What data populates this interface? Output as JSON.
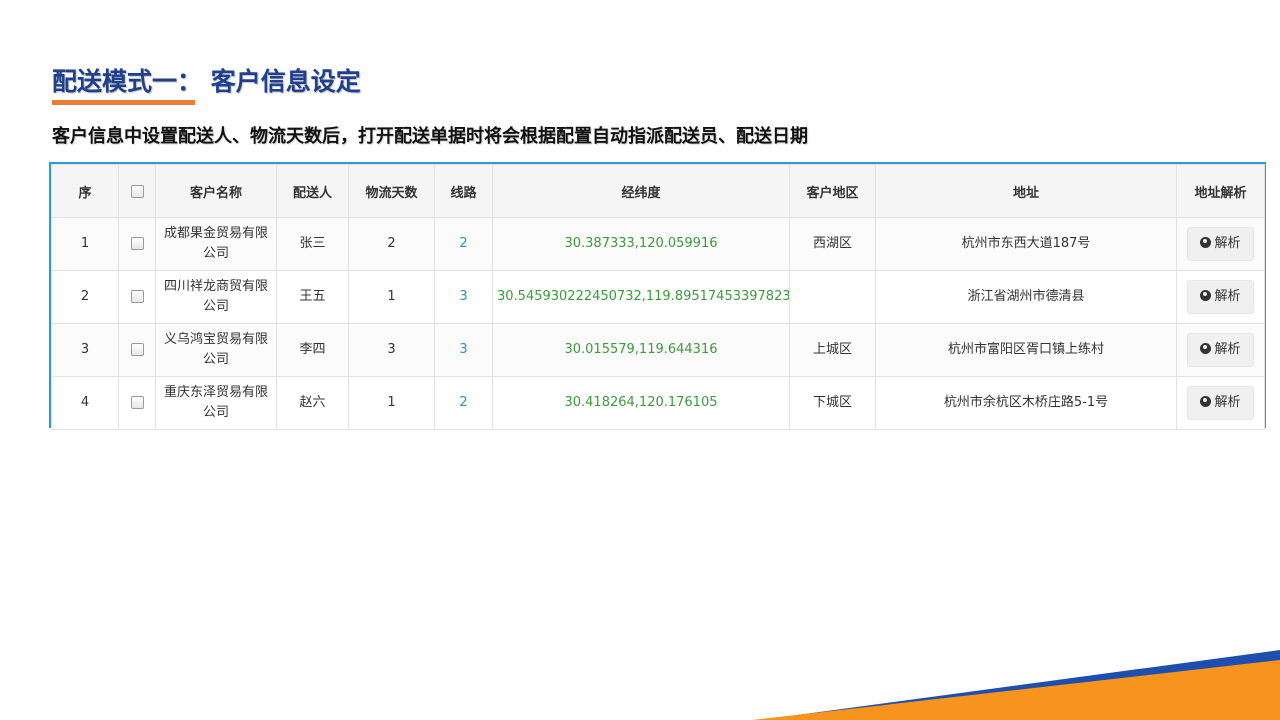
{
  "slide": {
    "title": "配送模式一： 客户信息设定",
    "subtitle": "客户信息中设置配送人、物流天数后，打开配送单据时将会根据配置自动指派配送员、配送日期"
  },
  "table": {
    "headers": {
      "seq": "序",
      "name": "客户名称",
      "courier": "配送人",
      "days": "物流天数",
      "route": "线路",
      "coord": "经纬度",
      "region": "客户地区",
      "address": "地址",
      "parse": "地址解析"
    },
    "rows": [
      {
        "seq": "1",
        "name": "成都果金贸易有限公司",
        "courier": "张三",
        "days": "2",
        "route": "2",
        "coord": "30.387333,120.059916",
        "region": "西湖区",
        "address": "杭州市东西大道187号",
        "parse": "解析"
      },
      {
        "seq": "2",
        "name": "四川祥龙商贸有限公司",
        "courier": "王五",
        "days": "1",
        "route": "3",
        "coord": "30.545930222450732,119.89517453397823",
        "region": "",
        "address": "浙江省湖州市德清县",
        "parse": "解析"
      },
      {
        "seq": "3",
        "name": "义乌鸿宝贸易有限公司",
        "courier": "李四",
        "days": "3",
        "route": "3",
        "coord": "30.015579,119.644316",
        "region": "上城区",
        "address": "杭州市富阳区胥口镇上练村",
        "parse": "解析"
      },
      {
        "seq": "4",
        "name": "重庆东泽贸易有限公司",
        "courier": "赵六",
        "days": "1",
        "route": "2",
        "coord": "30.418264,120.176105",
        "region": "下城区",
        "address": "杭州市余杭区木桥庄路5-1号",
        "parse": "解析"
      }
    ]
  },
  "colors": {
    "title": "#1f3f8f",
    "accent_orange": "#ed7d31",
    "accent_blue": "#1f4fae",
    "table_border": "#2e9bd6",
    "coord_green": "#3c9a3c",
    "route_blue": "#2a8fd4"
  },
  "icons": {
    "parse": "globe-icon"
  }
}
